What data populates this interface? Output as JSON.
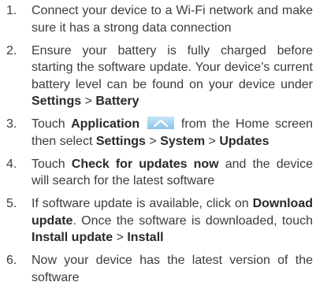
{
  "steps": [
    {
      "num": "1.",
      "parts": [
        "Connect your device to a Wi-Fi network and make sure it has a strong data connection"
      ]
    },
    {
      "num": "2.",
      "parts": [
        "Ensure your battery is fully charged before starting the software update. Your device’s current battery level can be found on your device under ",
        "Settings",
        " > ",
        "Battery"
      ]
    },
    {
      "num": "3.",
      "parts": [
        "Touch ",
        "Application",
        " from the Home screen then select ",
        "Settings",
        " > ",
        "System",
        " > ",
        "Updates"
      ],
      "icon": "application-chevron-up-icon"
    },
    {
      "num": "4.",
      "parts": [
        "Touch ",
        "Check for updates now",
        " and the device will search for the latest software"
      ]
    },
    {
      "num": "5.",
      "parts": [
        "If software update is available, click on ",
        "Download update",
        ". Once the software is downloaded, touch ",
        "Install update",
        " > ",
        "Install"
      ]
    },
    {
      "num": "6.",
      "parts": [
        "Now your device has the latest version of the software"
      ]
    }
  ],
  "colors": {
    "text": "#3c3c3c",
    "bold_text": "#2a2a2a",
    "icon_fill": "#9fd0f2",
    "icon_chevron": "#ffffff"
  }
}
